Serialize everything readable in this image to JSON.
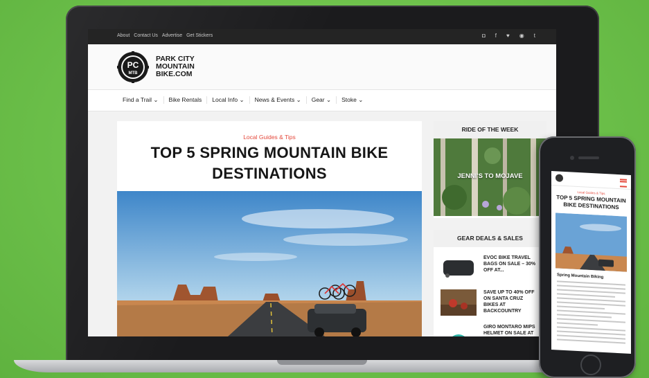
{
  "topbar": {
    "links": [
      "About",
      "Contact Us",
      "Advertise",
      "Get Stickers"
    ],
    "social_icons": [
      "instagram-icon",
      "facebook-icon",
      "twitter-icon",
      "pinterest-icon",
      "tumblr-icon"
    ],
    "social_glyphs": [
      "◘",
      "f",
      "♥",
      "◉",
      "t"
    ]
  },
  "header": {
    "logo_text": [
      "PARK CITY",
      "MOUNTAIN",
      "BIKE.COM"
    ],
    "logo_badge_top": "PC",
    "logo_badge_bottom": "MTB"
  },
  "nav": {
    "items": [
      "Find a Trail ⌄",
      "Bike Rentals",
      "Local Info ⌄",
      "News & Events ⌄",
      "Gear ⌄",
      "Stoke ⌄"
    ]
  },
  "article": {
    "category": "Local Guides & Tips",
    "title": "TOP 5 SPRING MOUNTAIN BIKE DESTINATIONS"
  },
  "sidebar": {
    "ride_title": "RIDE OF THE WEEK",
    "ride_caption": "JENNI'S TO MOJAVE",
    "gear_title": "GEAR DEALS & SALES",
    "deals": [
      "EVOC BIKE TRAVEL BAGS ON SALE – 30% OFF AT...",
      "SAVE UP TO 40% OFF ON SANTA CRUZ BIKES AT BACKCOUNTRY",
      "GIRO MONTARO MIPS HELMET ON SALE AT"
    ]
  },
  "phone": {
    "category": "Local Guides & Tips",
    "title": "TOP 5 SPRING MOUNTAIN BIKE DESTINATIONS",
    "subtitle": "Spring Mountain Biking"
  },
  "colors": {
    "background": "#6cc04a",
    "accent": "#e4483b",
    "topbar": "#242424"
  }
}
